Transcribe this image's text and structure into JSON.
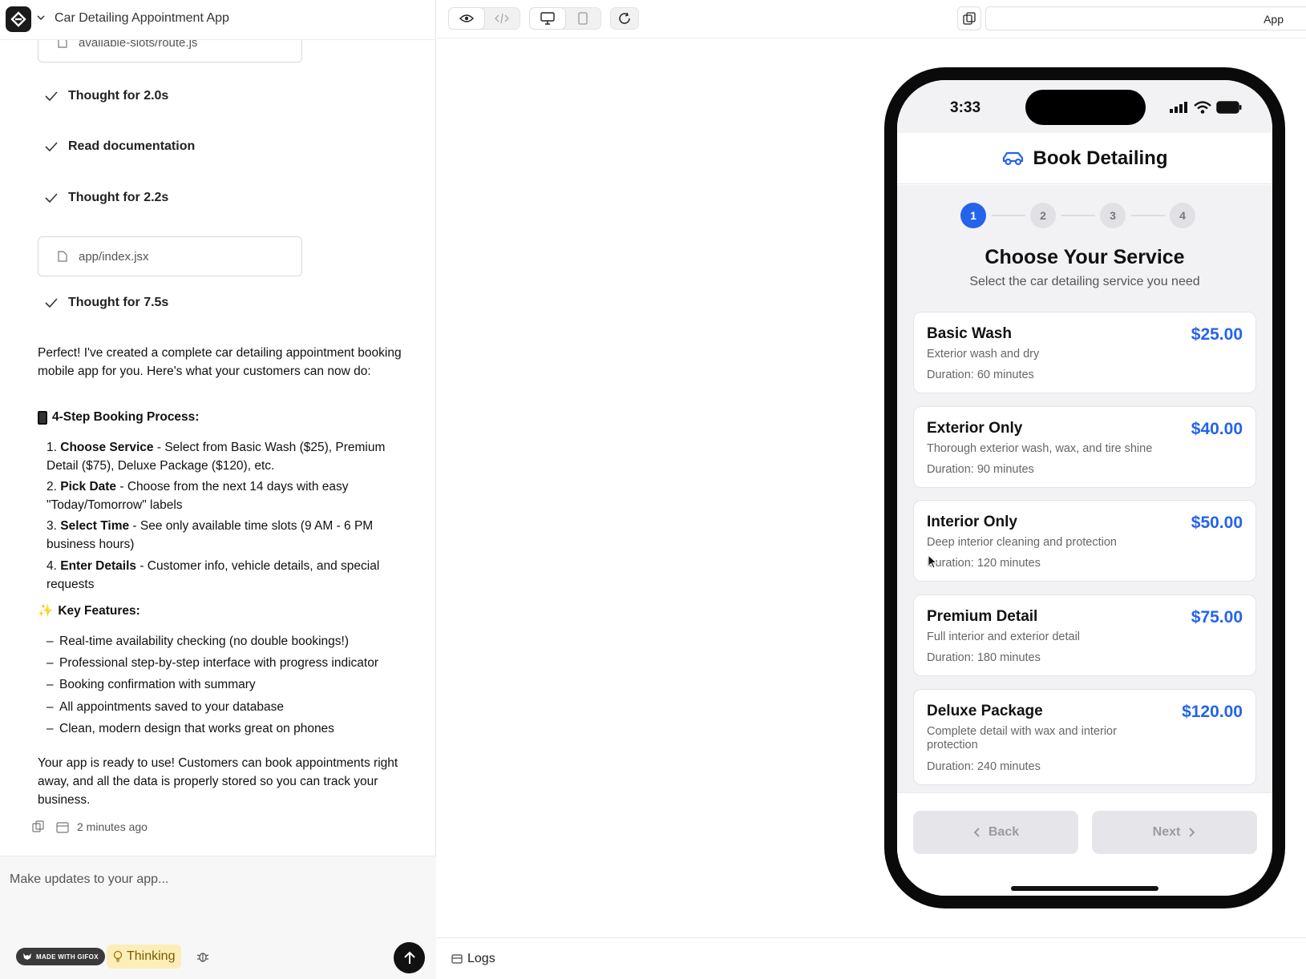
{
  "app": {
    "title": "Car Detailing Appointment App"
  },
  "chat": {
    "file_chip_top": "available-slots/route.js",
    "steps": [
      {
        "label": "Thought for 2.0s"
      },
      {
        "label": "Read documentation"
      },
      {
        "label": "Thought for 2.2s"
      }
    ],
    "file_chip_mid": "app/index.jsx",
    "step_after_file": "Thought for 7.5s",
    "intro": "Perfect! I've created a complete car detailing appointment booking mobile app for you. Here's what your customers can now do:",
    "booking_header": "4-Step Booking Process:",
    "booking_steps": [
      {
        "num": "1.",
        "bold": "Choose Service",
        "rest": " - Select from Basic Wash ($25), Premium Detail ($75), Deluxe Package ($120), etc."
      },
      {
        "num": "2.",
        "bold": "Pick Date",
        "rest": " - Choose from the next 14 days with easy \"Today/Tomorrow\" labels"
      },
      {
        "num": "3.",
        "bold": "Select Time",
        "rest": " - See only available time slots (9 AM - 6 PM business hours)"
      },
      {
        "num": "4.",
        "bold": "Enter Details",
        "rest": " - Customer info, vehicle details, and special requests"
      }
    ],
    "features_emoji": "✨",
    "features_header": "Key Features:",
    "features": [
      "Real-time availability checking (no double bookings!)",
      "Professional step-by-step interface with progress indicator",
      "Booking confirmation with summary",
      "All appointments saved to your database",
      "Clean, modern design that works great on phones"
    ],
    "closing": "Your app is ready to use! Customers can book appointments right away, and all the data is properly stored so you can track your business.",
    "timestamp": "2 minutes ago"
  },
  "composer": {
    "placeholder": "Make updates to your app...",
    "gifox_badge": "MADE WITH GIFOX",
    "thinking_label": "Thinking"
  },
  "preview": {
    "url_label": "App",
    "logs_label": "Logs"
  },
  "phone": {
    "time": "3:33",
    "header_title": "Book Detailing",
    "steps": [
      "1",
      "2",
      "3",
      "4"
    ],
    "active_step": 1,
    "title": "Choose Your Service",
    "subtitle": "Select the car detailing service you need",
    "services": [
      {
        "name": "Basic Wash",
        "price": "$25.00",
        "desc": "Exterior wash and dry",
        "duration": "Duration: 60 minutes"
      },
      {
        "name": "Exterior Only",
        "price": "$40.00",
        "desc": "Thorough exterior wash, wax, and tire shine",
        "duration": "Duration: 90 minutes"
      },
      {
        "name": "Interior Only",
        "price": "$50.00",
        "desc": "Deep interior cleaning and protection",
        "duration": "Duration: 120 minutes"
      },
      {
        "name": "Premium Detail",
        "price": "$75.00",
        "desc": "Full interior and exterior detail",
        "duration": "Duration: 180 minutes"
      },
      {
        "name": "Deluxe Package",
        "price": "$120.00",
        "desc": "Complete detail with wax and interior protection",
        "duration": "Duration: 240 minutes"
      }
    ],
    "back_label": "Back",
    "next_label": "Next"
  },
  "colors": {
    "accent": "#2563eb",
    "thinking_bg": "#fdeeb8"
  }
}
